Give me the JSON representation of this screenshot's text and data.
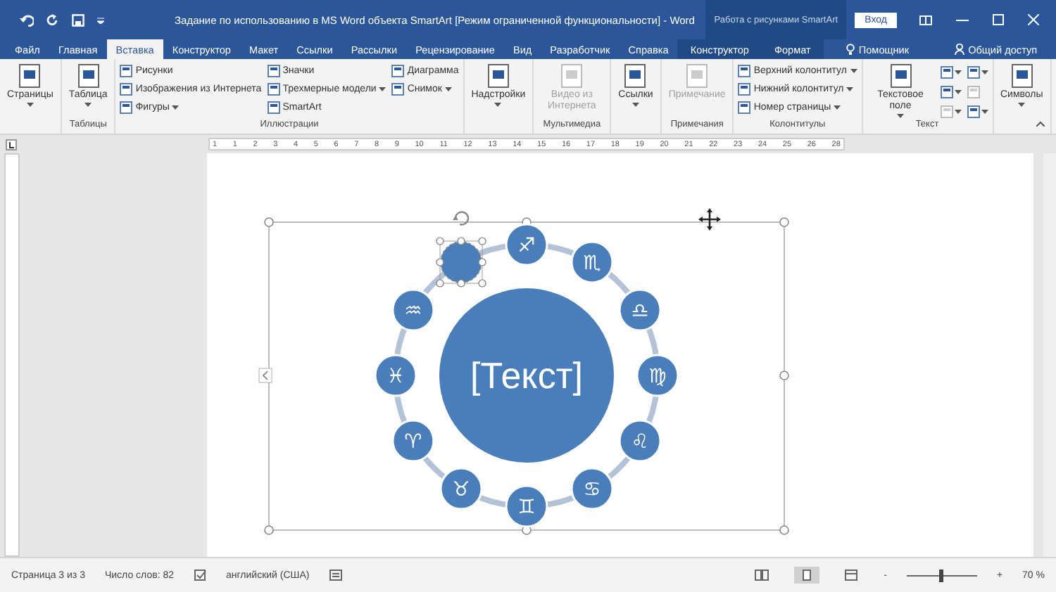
{
  "window": {
    "title": "Задание по использованию в MS Word объекта SmartArt [Режим ограниченной функциональности] - Word",
    "context_header": "Работа с рисунками SmartArt",
    "sign_in": "Вход"
  },
  "tabs": [
    {
      "label": "Файл",
      "selected": false,
      "contextual": false
    },
    {
      "label": "Главная",
      "selected": false,
      "contextual": false
    },
    {
      "label": "Вставка",
      "selected": true,
      "contextual": false
    },
    {
      "label": "Конструктор",
      "selected": false,
      "contextual": false
    },
    {
      "label": "Макет",
      "selected": false,
      "contextual": false
    },
    {
      "label": "Ссылки",
      "selected": false,
      "contextual": false
    },
    {
      "label": "Рассылки",
      "selected": false,
      "contextual": false
    },
    {
      "label": "Рецензирование",
      "selected": false,
      "contextual": false
    },
    {
      "label": "Вид",
      "selected": false,
      "contextual": false
    },
    {
      "label": "Разработчик",
      "selected": false,
      "contextual": false
    },
    {
      "label": "Справка",
      "selected": false,
      "contextual": false
    },
    {
      "label": "Конструктор",
      "selected": false,
      "contextual": true
    },
    {
      "label": "Формат",
      "selected": false,
      "contextual": true
    }
  ],
  "assistant": "Помощник",
  "share": "Общий доступ",
  "ribbon": {
    "groups": [
      {
        "columns": [
          {
            "kind": "large",
            "label": "Страницы",
            "dropdown": true,
            "disabled": false
          }
        ]
      },
      {
        "label": "Таблицы",
        "columns": [
          {
            "kind": "large",
            "label": "Таблица",
            "dropdown": true,
            "disabled": false
          }
        ]
      },
      {
        "label": "Иллюстрации",
        "columns": [
          {
            "kind": "stack",
            "items": [
              {
                "label": "Рисунки",
                "dropdown": false
              },
              {
                "label": "Изображения из Интернета",
                "dropdown": false
              },
              {
                "label": "Фигуры",
                "dropdown": true
              }
            ]
          },
          {
            "kind": "stack",
            "items": [
              {
                "label": "Значки",
                "dropdown": false
              },
              {
                "label": "Трехмерные модели",
                "dropdown": true
              },
              {
                "label": "SmartArt",
                "dropdown": false
              }
            ]
          },
          {
            "kind": "stack",
            "items": [
              {
                "label": "Диаграмма",
                "dropdown": false
              },
              {
                "label": "Снимок",
                "dropdown": true
              }
            ]
          }
        ]
      },
      {
        "columns": [
          {
            "kind": "large",
            "label": "Надстройки",
            "dropdown": true,
            "disabled": false
          }
        ]
      },
      {
        "label": "Мультимедиа",
        "columns": [
          {
            "kind": "large",
            "label": "Видео из Интернета",
            "dropdown": false,
            "disabled": true
          }
        ]
      },
      {
        "columns": [
          {
            "kind": "large",
            "label": "Ссылки",
            "dropdown": true,
            "disabled": false
          }
        ]
      },
      {
        "label": "Примечания",
        "columns": [
          {
            "kind": "large",
            "label": "Примечание",
            "dropdown": false,
            "disabled": true
          }
        ]
      },
      {
        "label": "Колонтитулы",
        "columns": [
          {
            "kind": "stack",
            "items": [
              {
                "label": "Верхний колонтитул",
                "dropdown": true
              },
              {
                "label": "Нижний колонтитул",
                "dropdown": true
              },
              {
                "label": "Номер страницы",
                "dropdown": true
              }
            ]
          }
        ]
      },
      {
        "label": "Текст",
        "columns": [
          {
            "kind": "large",
            "label": "Текстовое поле",
            "dropdown": true,
            "disabled": false
          },
          {
            "kind": "icons",
            "items": [
              {
                "dropdown": true,
                "disabled": false
              },
              {
                "dropdown": true,
                "disabled": false
              },
              {
                "dropdown": true,
                "disabled": false
              },
              {
                "dropdown": false,
                "disabled": true
              },
              {
                "dropdown": true,
                "disabled": true
              },
              {
                "dropdown": true,
                "disabled": false
              }
            ]
          }
        ]
      },
      {
        "columns": [
          {
            "kind": "large",
            "label": "Символы",
            "dropdown": true,
            "disabled": false
          }
        ]
      }
    ]
  },
  "ruler": {
    "marks": [
      "1",
      "1",
      "2",
      "3",
      "4",
      "5",
      "6",
      "7",
      "8",
      "9",
      "10",
      "11",
      "12",
      "13",
      "14",
      "15",
      "16",
      "17",
      "18",
      "19",
      "20",
      "21",
      "22",
      "23",
      "24",
      "25",
      "26",
      "28"
    ]
  },
  "smartart": {
    "center": "[Текст]",
    "nodes": [
      {
        "symbol": "♐",
        "selected": false
      },
      {
        "symbol": "♏",
        "selected": false
      },
      {
        "symbol": "♎",
        "selected": false
      },
      {
        "symbol": "♍",
        "selected": false
      },
      {
        "symbol": "♌",
        "selected": false
      },
      {
        "symbol": "♋",
        "selected": false
      },
      {
        "symbol": "♊",
        "selected": false
      },
      {
        "symbol": "♉",
        "selected": false
      },
      {
        "symbol": "♈",
        "selected": false
      },
      {
        "symbol": "♓",
        "selected": false
      },
      {
        "symbol": "♒",
        "selected": false
      },
      {
        "selected": true
      }
    ]
  },
  "status_bar": {
    "page": "Страница 3 из 3",
    "words": "Число слов: 82",
    "language": "английский (США)",
    "zoom_out": "-",
    "zoom_in": "+",
    "zoom": "70 %",
    "zoom_level": {
      "level": 0.5
    }
  }
}
